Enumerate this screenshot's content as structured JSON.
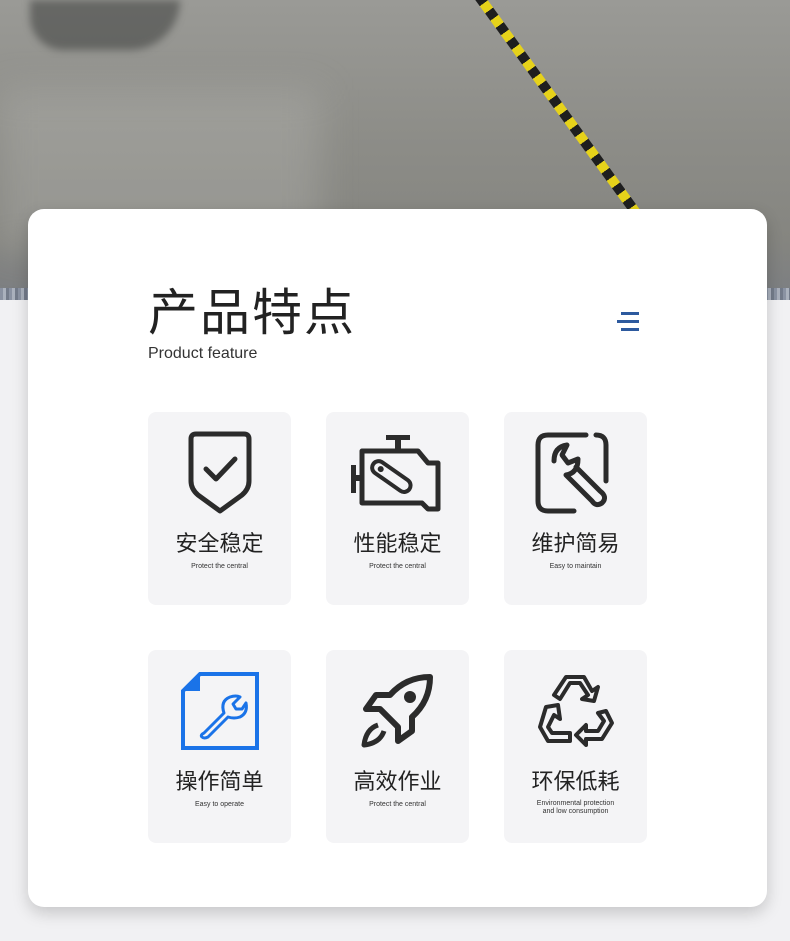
{
  "header": {
    "title": "产品特点",
    "subtitle": "Product feature"
  },
  "colors": {
    "accent": "#2d5a9e",
    "blue_icon": "#1a73e8",
    "tile_bg": "#f4f4f6"
  },
  "features": [
    {
      "title": "安全稳定",
      "subtitle": "Protect the central",
      "icon": "shield-check-icon"
    },
    {
      "title": "性能稳定",
      "subtitle": "Protect the central",
      "icon": "engine-icon"
    },
    {
      "title": "维护简易",
      "subtitle": "Easy to maintain",
      "icon": "wrench-icon"
    },
    {
      "title": "操作简单",
      "subtitle": "Easy to operate",
      "icon": "document-wrench-icon"
    },
    {
      "title": "高效作业",
      "subtitle": "Protect the central",
      "icon": "rocket-icon"
    },
    {
      "title": "环保低耗",
      "subtitle_line1": "Environmental protection",
      "subtitle_line2": "and low consumption",
      "icon": "recycle-icon"
    }
  ]
}
